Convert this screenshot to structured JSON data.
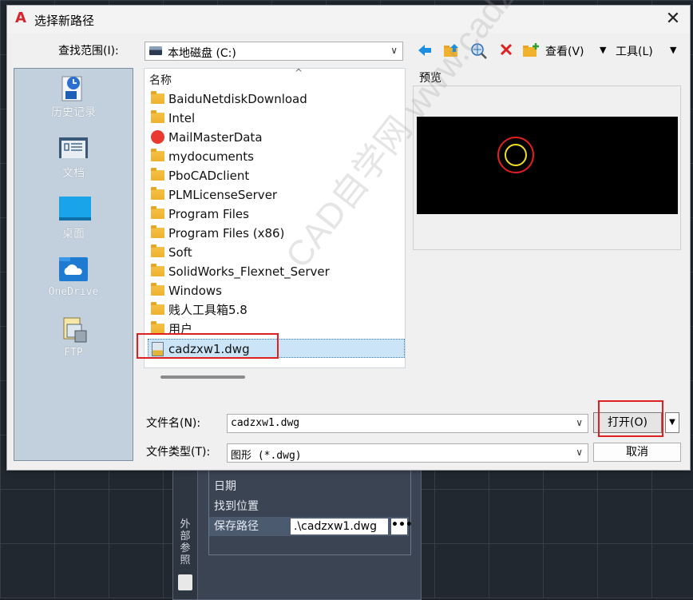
{
  "dialog": {
    "title": "选择新路径",
    "lookin_label": "查找范围(I):",
    "lookin_value": "本地磁盘 (C:)",
    "view_label": "查看(V)",
    "tools_label": "工具(L)",
    "preview_label": "预览",
    "filename_label": "文件名(N):",
    "filename_value": "cadzxw1.dwg",
    "filetype_label": "文件类型(T):",
    "filetype_value": "图形 (*.dwg)",
    "open_label": "打开(O)",
    "cancel_label": "取消"
  },
  "places": [
    {
      "label": "历史记录",
      "icon": "history-icon"
    },
    {
      "label": "文档",
      "icon": "documents-icon"
    },
    {
      "label": "桌面",
      "icon": "desktop-icon"
    },
    {
      "label": "OneDrive",
      "icon": "onedrive-icon"
    },
    {
      "label": "FTP",
      "icon": "ftp-icon"
    }
  ],
  "filelist": {
    "column_name": "名称",
    "items": [
      {
        "name": "BaiduNetdiskDownload",
        "type": "folder"
      },
      {
        "name": "Intel",
        "type": "folder"
      },
      {
        "name": "MailMasterData",
        "type": "mailmaster"
      },
      {
        "name": "mydocuments",
        "type": "folder"
      },
      {
        "name": "PboCADclient",
        "type": "folder"
      },
      {
        "name": "PLMLicenseServer",
        "type": "folder"
      },
      {
        "name": "Program Files",
        "type": "folder"
      },
      {
        "name": "Program Files (x86)",
        "type": "folder"
      },
      {
        "name": "Soft",
        "type": "folder"
      },
      {
        "name": "SolidWorks_Flexnet_Server",
        "type": "folder"
      },
      {
        "name": "Windows",
        "type": "folder"
      },
      {
        "name": "贱人工具箱5.8",
        "type": "folder"
      },
      {
        "name": "用户",
        "type": "folder"
      },
      {
        "name": "cadzxw1.dwg",
        "type": "dwg"
      }
    ]
  },
  "xref_panel": {
    "side_title": "外部参照",
    "rows": [
      "日期",
      "找到位置",
      "保存路径"
    ],
    "save_path_value": ".\\cadzxw1.dwg",
    "dots": "•••"
  },
  "watermark": "CAD自学网 www.cadzxw.com",
  "colors": {
    "highlight": "#e02020",
    "selected_row": "#cce4f7",
    "places_bg": "#c2cfdc"
  }
}
